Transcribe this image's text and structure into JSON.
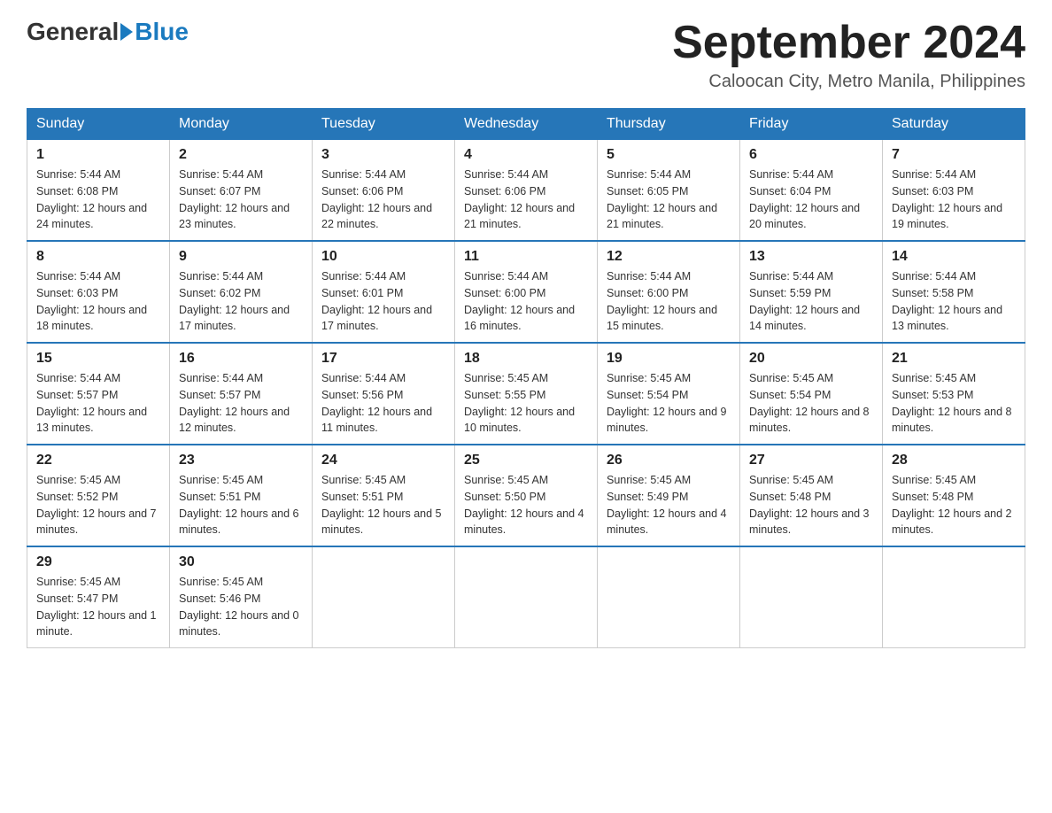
{
  "header": {
    "logo_general": "General",
    "logo_blue": "Blue",
    "main_title": "September 2024",
    "subtitle": "Caloocan City, Metro Manila, Philippines"
  },
  "calendar": {
    "days_of_week": [
      "Sunday",
      "Monday",
      "Tuesday",
      "Wednesday",
      "Thursday",
      "Friday",
      "Saturday"
    ],
    "weeks": [
      [
        {
          "day": "1",
          "sunrise": "Sunrise: 5:44 AM",
          "sunset": "Sunset: 6:08 PM",
          "daylight": "Daylight: 12 hours and 24 minutes."
        },
        {
          "day": "2",
          "sunrise": "Sunrise: 5:44 AM",
          "sunset": "Sunset: 6:07 PM",
          "daylight": "Daylight: 12 hours and 23 minutes."
        },
        {
          "day": "3",
          "sunrise": "Sunrise: 5:44 AM",
          "sunset": "Sunset: 6:06 PM",
          "daylight": "Daylight: 12 hours and 22 minutes."
        },
        {
          "day": "4",
          "sunrise": "Sunrise: 5:44 AM",
          "sunset": "Sunset: 6:06 PM",
          "daylight": "Daylight: 12 hours and 21 minutes."
        },
        {
          "day": "5",
          "sunrise": "Sunrise: 5:44 AM",
          "sunset": "Sunset: 6:05 PM",
          "daylight": "Daylight: 12 hours and 21 minutes."
        },
        {
          "day": "6",
          "sunrise": "Sunrise: 5:44 AM",
          "sunset": "Sunset: 6:04 PM",
          "daylight": "Daylight: 12 hours and 20 minutes."
        },
        {
          "day": "7",
          "sunrise": "Sunrise: 5:44 AM",
          "sunset": "Sunset: 6:03 PM",
          "daylight": "Daylight: 12 hours and 19 minutes."
        }
      ],
      [
        {
          "day": "8",
          "sunrise": "Sunrise: 5:44 AM",
          "sunset": "Sunset: 6:03 PM",
          "daylight": "Daylight: 12 hours and 18 minutes."
        },
        {
          "day": "9",
          "sunrise": "Sunrise: 5:44 AM",
          "sunset": "Sunset: 6:02 PM",
          "daylight": "Daylight: 12 hours and 17 minutes."
        },
        {
          "day": "10",
          "sunrise": "Sunrise: 5:44 AM",
          "sunset": "Sunset: 6:01 PM",
          "daylight": "Daylight: 12 hours and 17 minutes."
        },
        {
          "day": "11",
          "sunrise": "Sunrise: 5:44 AM",
          "sunset": "Sunset: 6:00 PM",
          "daylight": "Daylight: 12 hours and 16 minutes."
        },
        {
          "day": "12",
          "sunrise": "Sunrise: 5:44 AM",
          "sunset": "Sunset: 6:00 PM",
          "daylight": "Daylight: 12 hours and 15 minutes."
        },
        {
          "day": "13",
          "sunrise": "Sunrise: 5:44 AM",
          "sunset": "Sunset: 5:59 PM",
          "daylight": "Daylight: 12 hours and 14 minutes."
        },
        {
          "day": "14",
          "sunrise": "Sunrise: 5:44 AM",
          "sunset": "Sunset: 5:58 PM",
          "daylight": "Daylight: 12 hours and 13 minutes."
        }
      ],
      [
        {
          "day": "15",
          "sunrise": "Sunrise: 5:44 AM",
          "sunset": "Sunset: 5:57 PM",
          "daylight": "Daylight: 12 hours and 13 minutes."
        },
        {
          "day": "16",
          "sunrise": "Sunrise: 5:44 AM",
          "sunset": "Sunset: 5:57 PM",
          "daylight": "Daylight: 12 hours and 12 minutes."
        },
        {
          "day": "17",
          "sunrise": "Sunrise: 5:44 AM",
          "sunset": "Sunset: 5:56 PM",
          "daylight": "Daylight: 12 hours and 11 minutes."
        },
        {
          "day": "18",
          "sunrise": "Sunrise: 5:45 AM",
          "sunset": "Sunset: 5:55 PM",
          "daylight": "Daylight: 12 hours and 10 minutes."
        },
        {
          "day": "19",
          "sunrise": "Sunrise: 5:45 AM",
          "sunset": "Sunset: 5:54 PM",
          "daylight": "Daylight: 12 hours and 9 minutes."
        },
        {
          "day": "20",
          "sunrise": "Sunrise: 5:45 AM",
          "sunset": "Sunset: 5:54 PM",
          "daylight": "Daylight: 12 hours and 8 minutes."
        },
        {
          "day": "21",
          "sunrise": "Sunrise: 5:45 AM",
          "sunset": "Sunset: 5:53 PM",
          "daylight": "Daylight: 12 hours and 8 minutes."
        }
      ],
      [
        {
          "day": "22",
          "sunrise": "Sunrise: 5:45 AM",
          "sunset": "Sunset: 5:52 PM",
          "daylight": "Daylight: 12 hours and 7 minutes."
        },
        {
          "day": "23",
          "sunrise": "Sunrise: 5:45 AM",
          "sunset": "Sunset: 5:51 PM",
          "daylight": "Daylight: 12 hours and 6 minutes."
        },
        {
          "day": "24",
          "sunrise": "Sunrise: 5:45 AM",
          "sunset": "Sunset: 5:51 PM",
          "daylight": "Daylight: 12 hours and 5 minutes."
        },
        {
          "day": "25",
          "sunrise": "Sunrise: 5:45 AM",
          "sunset": "Sunset: 5:50 PM",
          "daylight": "Daylight: 12 hours and 4 minutes."
        },
        {
          "day": "26",
          "sunrise": "Sunrise: 5:45 AM",
          "sunset": "Sunset: 5:49 PM",
          "daylight": "Daylight: 12 hours and 4 minutes."
        },
        {
          "day": "27",
          "sunrise": "Sunrise: 5:45 AM",
          "sunset": "Sunset: 5:48 PM",
          "daylight": "Daylight: 12 hours and 3 minutes."
        },
        {
          "day": "28",
          "sunrise": "Sunrise: 5:45 AM",
          "sunset": "Sunset: 5:48 PM",
          "daylight": "Daylight: 12 hours and 2 minutes."
        }
      ],
      [
        {
          "day": "29",
          "sunrise": "Sunrise: 5:45 AM",
          "sunset": "Sunset: 5:47 PM",
          "daylight": "Daylight: 12 hours and 1 minute."
        },
        {
          "day": "30",
          "sunrise": "Sunrise: 5:45 AM",
          "sunset": "Sunset: 5:46 PM",
          "daylight": "Daylight: 12 hours and 0 minutes."
        },
        null,
        null,
        null,
        null,
        null
      ]
    ]
  }
}
